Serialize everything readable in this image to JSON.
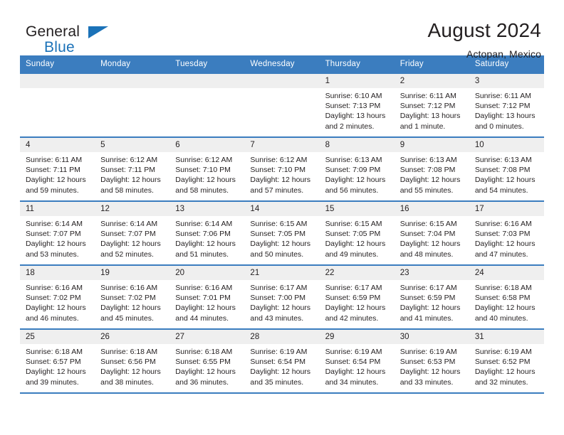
{
  "brand": {
    "name_part1": "General",
    "name_part2": "Blue",
    "triangle_icon": "blue-triangle-icon",
    "accent_color": "#1b72b8"
  },
  "header": {
    "title": "August 2024",
    "subtitle": "Actopan, Mexico"
  },
  "theme": {
    "header_row_bg": "#3b7dbf",
    "daynum_bg": "#efefef",
    "row_border": "#3b7dbf",
    "text": "#231f20"
  },
  "calendar": {
    "weekday_headers": [
      "Sunday",
      "Monday",
      "Tuesday",
      "Wednesday",
      "Thursday",
      "Friday",
      "Saturday"
    ],
    "weeks": [
      [
        {
          "day": "",
          "blank": true
        },
        {
          "day": "",
          "blank": true
        },
        {
          "day": "",
          "blank": true
        },
        {
          "day": "",
          "blank": true
        },
        {
          "day": "1",
          "sunrise": "Sunrise: 6:10 AM",
          "sunset": "Sunset: 7:13 PM",
          "daylight_1": "Daylight: 13 hours",
          "daylight_2": "and 2 minutes."
        },
        {
          "day": "2",
          "sunrise": "Sunrise: 6:11 AM",
          "sunset": "Sunset: 7:12 PM",
          "daylight_1": "Daylight: 13 hours",
          "daylight_2": "and 1 minute."
        },
        {
          "day": "3",
          "sunrise": "Sunrise: 6:11 AM",
          "sunset": "Sunset: 7:12 PM",
          "daylight_1": "Daylight: 13 hours",
          "daylight_2": "and 0 minutes."
        }
      ],
      [
        {
          "day": "4",
          "sunrise": "Sunrise: 6:11 AM",
          "sunset": "Sunset: 7:11 PM",
          "daylight_1": "Daylight: 12 hours",
          "daylight_2": "and 59 minutes."
        },
        {
          "day": "5",
          "sunrise": "Sunrise: 6:12 AM",
          "sunset": "Sunset: 7:11 PM",
          "daylight_1": "Daylight: 12 hours",
          "daylight_2": "and 58 minutes."
        },
        {
          "day": "6",
          "sunrise": "Sunrise: 6:12 AM",
          "sunset": "Sunset: 7:10 PM",
          "daylight_1": "Daylight: 12 hours",
          "daylight_2": "and 58 minutes."
        },
        {
          "day": "7",
          "sunrise": "Sunrise: 6:12 AM",
          "sunset": "Sunset: 7:10 PM",
          "daylight_1": "Daylight: 12 hours",
          "daylight_2": "and 57 minutes."
        },
        {
          "day": "8",
          "sunrise": "Sunrise: 6:13 AM",
          "sunset": "Sunset: 7:09 PM",
          "daylight_1": "Daylight: 12 hours",
          "daylight_2": "and 56 minutes."
        },
        {
          "day": "9",
          "sunrise": "Sunrise: 6:13 AM",
          "sunset": "Sunset: 7:08 PM",
          "daylight_1": "Daylight: 12 hours",
          "daylight_2": "and 55 minutes."
        },
        {
          "day": "10",
          "sunrise": "Sunrise: 6:13 AM",
          "sunset": "Sunset: 7:08 PM",
          "daylight_1": "Daylight: 12 hours",
          "daylight_2": "and 54 minutes."
        }
      ],
      [
        {
          "day": "11",
          "sunrise": "Sunrise: 6:14 AM",
          "sunset": "Sunset: 7:07 PM",
          "daylight_1": "Daylight: 12 hours",
          "daylight_2": "and 53 minutes."
        },
        {
          "day": "12",
          "sunrise": "Sunrise: 6:14 AM",
          "sunset": "Sunset: 7:07 PM",
          "daylight_1": "Daylight: 12 hours",
          "daylight_2": "and 52 minutes."
        },
        {
          "day": "13",
          "sunrise": "Sunrise: 6:14 AM",
          "sunset": "Sunset: 7:06 PM",
          "daylight_1": "Daylight: 12 hours",
          "daylight_2": "and 51 minutes."
        },
        {
          "day": "14",
          "sunrise": "Sunrise: 6:15 AM",
          "sunset": "Sunset: 7:05 PM",
          "daylight_1": "Daylight: 12 hours",
          "daylight_2": "and 50 minutes."
        },
        {
          "day": "15",
          "sunrise": "Sunrise: 6:15 AM",
          "sunset": "Sunset: 7:05 PM",
          "daylight_1": "Daylight: 12 hours",
          "daylight_2": "and 49 minutes."
        },
        {
          "day": "16",
          "sunrise": "Sunrise: 6:15 AM",
          "sunset": "Sunset: 7:04 PM",
          "daylight_1": "Daylight: 12 hours",
          "daylight_2": "and 48 minutes."
        },
        {
          "day": "17",
          "sunrise": "Sunrise: 6:16 AM",
          "sunset": "Sunset: 7:03 PM",
          "daylight_1": "Daylight: 12 hours",
          "daylight_2": "and 47 minutes."
        }
      ],
      [
        {
          "day": "18",
          "sunrise": "Sunrise: 6:16 AM",
          "sunset": "Sunset: 7:02 PM",
          "daylight_1": "Daylight: 12 hours",
          "daylight_2": "and 46 minutes."
        },
        {
          "day": "19",
          "sunrise": "Sunrise: 6:16 AM",
          "sunset": "Sunset: 7:02 PM",
          "daylight_1": "Daylight: 12 hours",
          "daylight_2": "and 45 minutes."
        },
        {
          "day": "20",
          "sunrise": "Sunrise: 6:16 AM",
          "sunset": "Sunset: 7:01 PM",
          "daylight_1": "Daylight: 12 hours",
          "daylight_2": "and 44 minutes."
        },
        {
          "day": "21",
          "sunrise": "Sunrise: 6:17 AM",
          "sunset": "Sunset: 7:00 PM",
          "daylight_1": "Daylight: 12 hours",
          "daylight_2": "and 43 minutes."
        },
        {
          "day": "22",
          "sunrise": "Sunrise: 6:17 AM",
          "sunset": "Sunset: 6:59 PM",
          "daylight_1": "Daylight: 12 hours",
          "daylight_2": "and 42 minutes."
        },
        {
          "day": "23",
          "sunrise": "Sunrise: 6:17 AM",
          "sunset": "Sunset: 6:59 PM",
          "daylight_1": "Daylight: 12 hours",
          "daylight_2": "and 41 minutes."
        },
        {
          "day": "24",
          "sunrise": "Sunrise: 6:18 AM",
          "sunset": "Sunset: 6:58 PM",
          "daylight_1": "Daylight: 12 hours",
          "daylight_2": "and 40 minutes."
        }
      ],
      [
        {
          "day": "25",
          "sunrise": "Sunrise: 6:18 AM",
          "sunset": "Sunset: 6:57 PM",
          "daylight_1": "Daylight: 12 hours",
          "daylight_2": "and 39 minutes."
        },
        {
          "day": "26",
          "sunrise": "Sunrise: 6:18 AM",
          "sunset": "Sunset: 6:56 PM",
          "daylight_1": "Daylight: 12 hours",
          "daylight_2": "and 38 minutes."
        },
        {
          "day": "27",
          "sunrise": "Sunrise: 6:18 AM",
          "sunset": "Sunset: 6:55 PM",
          "daylight_1": "Daylight: 12 hours",
          "daylight_2": "and 36 minutes."
        },
        {
          "day": "28",
          "sunrise": "Sunrise: 6:19 AM",
          "sunset": "Sunset: 6:54 PM",
          "daylight_1": "Daylight: 12 hours",
          "daylight_2": "and 35 minutes."
        },
        {
          "day": "29",
          "sunrise": "Sunrise: 6:19 AM",
          "sunset": "Sunset: 6:54 PM",
          "daylight_1": "Daylight: 12 hours",
          "daylight_2": "and 34 minutes."
        },
        {
          "day": "30",
          "sunrise": "Sunrise: 6:19 AM",
          "sunset": "Sunset: 6:53 PM",
          "daylight_1": "Daylight: 12 hours",
          "daylight_2": "and 33 minutes."
        },
        {
          "day": "31",
          "sunrise": "Sunrise: 6:19 AM",
          "sunset": "Sunset: 6:52 PM",
          "daylight_1": "Daylight: 12 hours",
          "daylight_2": "and 32 minutes."
        }
      ]
    ]
  }
}
